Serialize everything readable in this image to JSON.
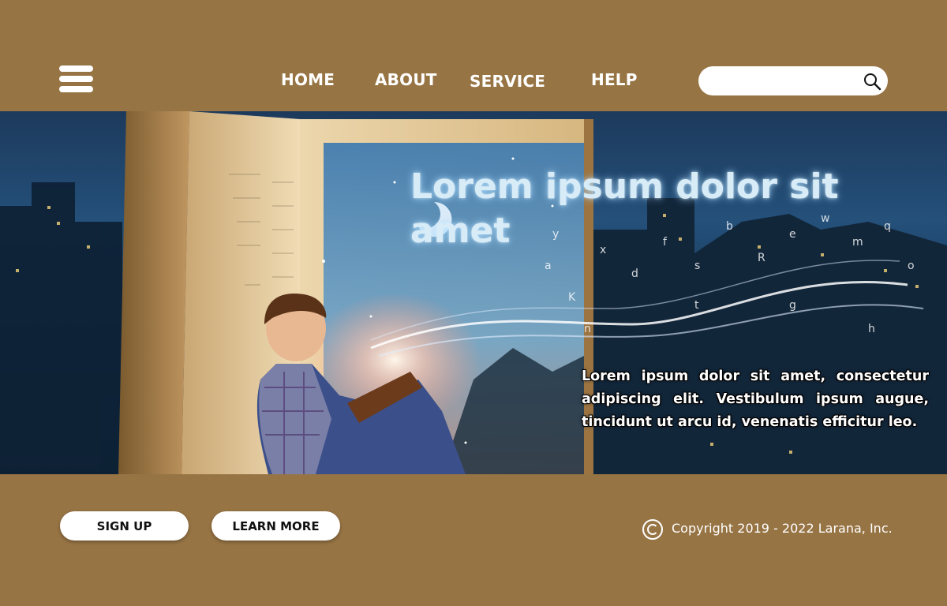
{
  "header": {
    "menu_icon": "hamburger-menu-icon",
    "nav": [
      {
        "label": "HOME"
      },
      {
        "label": "ABOUT"
      },
      {
        "label": "SERVICE"
      },
      {
        "label": "HELP"
      }
    ],
    "search": {
      "placeholder": "",
      "value": "",
      "icon": "search-icon"
    }
  },
  "hero": {
    "title": "Lorem ipsum dolor sit amet",
    "body": "Lorem ipsum dolor sit amet, consectetur adipiscing elit. Vestibulum ipsum augue, tincidunt ut arcu id, venenatis efficitur leo."
  },
  "footer": {
    "signup_label": "SIGN UP",
    "learn_more_label": "LEARN MORE",
    "copyright_icon": "copyright-icon",
    "copyright": "Copyright 2019 - 2022 Larana, Inc."
  },
  "colors": {
    "background": "#977444",
    "text": "#ffffff",
    "button": "#ffffff"
  }
}
